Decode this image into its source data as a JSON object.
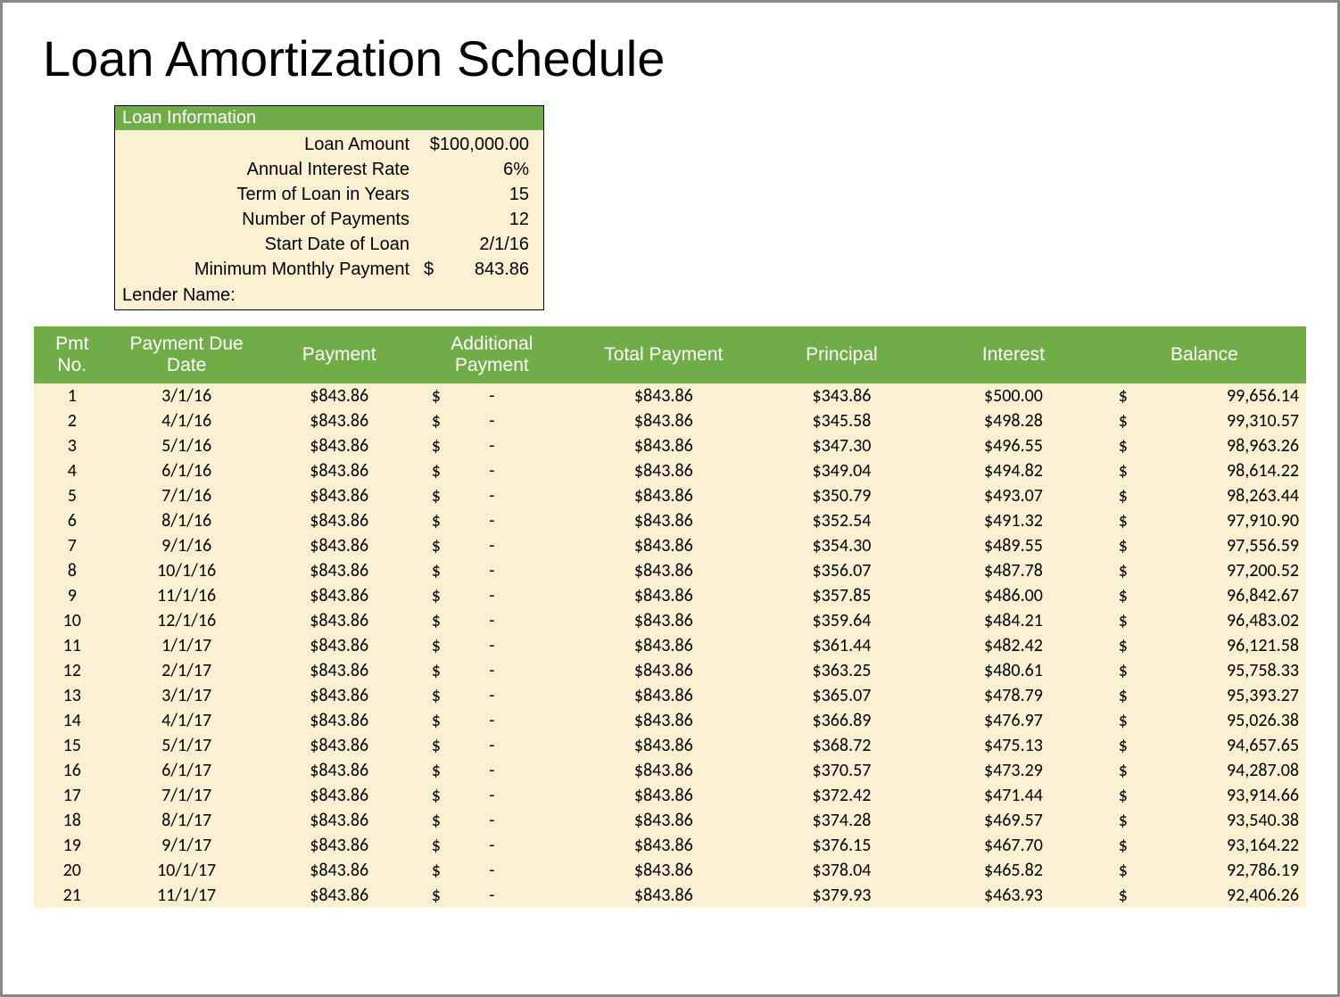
{
  "title": "Loan Amortization Schedule",
  "loan_info": {
    "header": "Loan Information",
    "rows": [
      {
        "label": "Loan Amount",
        "value": "$100,000.00"
      },
      {
        "label": "Annual Interest Rate",
        "value": "6%"
      },
      {
        "label": "Term of Loan in Years",
        "value": "15"
      },
      {
        "label": "Number of Payments",
        "value": "12"
      },
      {
        "label": "Start Date of Loan",
        "value": "2/1/16"
      },
      {
        "label": "Minimum Monthly Payment",
        "value": "843.86",
        "dollar_split": true
      }
    ],
    "lender_label": "Lender Name:"
  },
  "schedule": {
    "headers": [
      "Pmt No.",
      "Payment Due Date",
      "Payment",
      "Additional Payment",
      "Total Payment",
      "Principal",
      "Interest",
      "Balance"
    ],
    "rows": [
      {
        "no": "1",
        "date": "3/1/16",
        "payment": "$843.86",
        "additional": "-",
        "total": "$843.86",
        "principal": "$343.86",
        "interest": "$500.00",
        "balance": "99,656.14"
      },
      {
        "no": "2",
        "date": "4/1/16",
        "payment": "$843.86",
        "additional": "-",
        "total": "$843.86",
        "principal": "$345.58",
        "interest": "$498.28",
        "balance": "99,310.57"
      },
      {
        "no": "3",
        "date": "5/1/16",
        "payment": "$843.86",
        "additional": "-",
        "total": "$843.86",
        "principal": "$347.30",
        "interest": "$496.55",
        "balance": "98,963.26"
      },
      {
        "no": "4",
        "date": "6/1/16",
        "payment": "$843.86",
        "additional": "-",
        "total": "$843.86",
        "principal": "$349.04",
        "interest": "$494.82",
        "balance": "98,614.22"
      },
      {
        "no": "5",
        "date": "7/1/16",
        "payment": "$843.86",
        "additional": "-",
        "total": "$843.86",
        "principal": "$350.79",
        "interest": "$493.07",
        "balance": "98,263.44"
      },
      {
        "no": "6",
        "date": "8/1/16",
        "payment": "$843.86",
        "additional": "-",
        "total": "$843.86",
        "principal": "$352.54",
        "interest": "$491.32",
        "balance": "97,910.90"
      },
      {
        "no": "7",
        "date": "9/1/16",
        "payment": "$843.86",
        "additional": "-",
        "total": "$843.86",
        "principal": "$354.30",
        "interest": "$489.55",
        "balance": "97,556.59"
      },
      {
        "no": "8",
        "date": "10/1/16",
        "payment": "$843.86",
        "additional": "-",
        "total": "$843.86",
        "principal": "$356.07",
        "interest": "$487.78",
        "balance": "97,200.52"
      },
      {
        "no": "9",
        "date": "11/1/16",
        "payment": "$843.86",
        "additional": "-",
        "total": "$843.86",
        "principal": "$357.85",
        "interest": "$486.00",
        "balance": "96,842.67"
      },
      {
        "no": "10",
        "date": "12/1/16",
        "payment": "$843.86",
        "additional": "-",
        "total": "$843.86",
        "principal": "$359.64",
        "interest": "$484.21",
        "balance": "96,483.02"
      },
      {
        "no": "11",
        "date": "1/1/17",
        "payment": "$843.86",
        "additional": "-",
        "total": "$843.86",
        "principal": "$361.44",
        "interest": "$482.42",
        "balance": "96,121.58"
      },
      {
        "no": "12",
        "date": "2/1/17",
        "payment": "$843.86",
        "additional": "-",
        "total": "$843.86",
        "principal": "$363.25",
        "interest": "$480.61",
        "balance": "95,758.33"
      },
      {
        "no": "13",
        "date": "3/1/17",
        "payment": "$843.86",
        "additional": "-",
        "total": "$843.86",
        "principal": "$365.07",
        "interest": "$478.79",
        "balance": "95,393.27"
      },
      {
        "no": "14",
        "date": "4/1/17",
        "payment": "$843.86",
        "additional": "-",
        "total": "$843.86",
        "principal": "$366.89",
        "interest": "$476.97",
        "balance": "95,026.38"
      },
      {
        "no": "15",
        "date": "5/1/17",
        "payment": "$843.86",
        "additional": "-",
        "total": "$843.86",
        "principal": "$368.72",
        "interest": "$475.13",
        "balance": "94,657.65"
      },
      {
        "no": "16",
        "date": "6/1/17",
        "payment": "$843.86",
        "additional": "-",
        "total": "$843.86",
        "principal": "$370.57",
        "interest": "$473.29",
        "balance": "94,287.08"
      },
      {
        "no": "17",
        "date": "7/1/17",
        "payment": "$843.86",
        "additional": "-",
        "total": "$843.86",
        "principal": "$372.42",
        "interest": "$471.44",
        "balance": "93,914.66"
      },
      {
        "no": "18",
        "date": "8/1/17",
        "payment": "$843.86",
        "additional": "-",
        "total": "$843.86",
        "principal": "$374.28",
        "interest": "$469.57",
        "balance": "93,540.38"
      },
      {
        "no": "19",
        "date": "9/1/17",
        "payment": "$843.86",
        "additional": "-",
        "total": "$843.86",
        "principal": "$376.15",
        "interest": "$467.70",
        "balance": "93,164.22"
      },
      {
        "no": "20",
        "date": "10/1/17",
        "payment": "$843.86",
        "additional": "-",
        "total": "$843.86",
        "principal": "$378.04",
        "interest": "$465.82",
        "balance": "92,786.19"
      },
      {
        "no": "21",
        "date": "11/1/17",
        "payment": "$843.86",
        "additional": "-",
        "total": "$843.86",
        "principal": "$379.93",
        "interest": "$463.93",
        "balance": "92,406.26"
      }
    ]
  }
}
